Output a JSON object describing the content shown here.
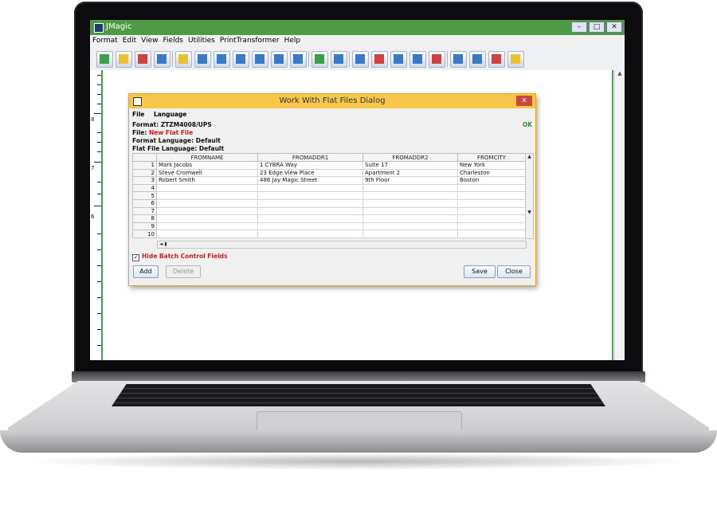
{
  "window": {
    "title": "JMagic"
  },
  "menu": [
    "Format",
    "Edit",
    "View",
    "Fields",
    "Utilities",
    "PrintTransformer",
    "Help"
  ],
  "ruler": {
    "numbers": [
      "8",
      "7",
      "6"
    ]
  },
  "dialog": {
    "title": "Work With Flat Files Dialog",
    "close_label": "x",
    "menu": [
      "File",
      "Language"
    ],
    "format_label": "Format: ZTZM4008/UPS",
    "file_label": "File:",
    "file_value": "New Flat File",
    "status": "OK",
    "format_language": "Format Language: Default",
    "flat_file_language": "Flat File Language: Default",
    "table": {
      "columns": [
        "",
        "FROMNAME",
        "FROMADDR1",
        "FROMADDR2",
        "FROMCITY"
      ],
      "rows": [
        [
          "1",
          "Mark Jacobs",
          "1 CYBRA Way",
          "Suite 17",
          "New York"
        ],
        [
          "2",
          "Steve Cromwell",
          "23 Edge View Place",
          "Apartment 2",
          "Charleston"
        ],
        [
          "3",
          "Robert Smith",
          "486 Jay Magic Street",
          "9th Floor",
          "Boston"
        ],
        [
          "4",
          "",
          "",
          "",
          ""
        ],
        [
          "5",
          "",
          "",
          "",
          ""
        ],
        [
          "6",
          "",
          "",
          "",
          ""
        ],
        [
          "7",
          "",
          "",
          "",
          ""
        ],
        [
          "8",
          "",
          "",
          "",
          ""
        ],
        [
          "9",
          "",
          "",
          "",
          ""
        ],
        [
          "10",
          "",
          "",
          "",
          ""
        ]
      ]
    },
    "hide_batch_label": "Hide Batch Control Fields",
    "hide_batch_checked": true,
    "buttons": {
      "add": "Add",
      "delete": "Delete",
      "save": "Save",
      "close": "Close"
    }
  }
}
